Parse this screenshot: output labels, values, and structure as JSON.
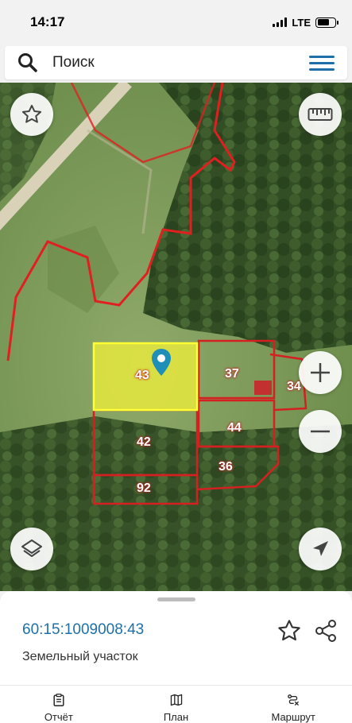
{
  "status_bar": {
    "time": "14:17",
    "network": "LTE"
  },
  "search": {
    "placeholder": "Поиск",
    "icon": "search-icon",
    "menu_icon": "hamburger-menu-icon"
  },
  "map": {
    "selected_parcel_label": "43",
    "parcel_labels": {
      "p43": "43",
      "p37": "37",
      "p34": "34",
      "p42": "42",
      "p44": "44",
      "p36": "36",
      "p92": "92"
    },
    "controls": {
      "favorite_icon": "star-icon",
      "ruler_icon": "ruler-icon",
      "zoom_in_icon": "plus-icon",
      "zoom_out_icon": "minus-icon",
      "layers_icon": "layers-icon",
      "location_icon": "navigation-arrow-icon"
    },
    "colors": {
      "boundary": "#e02020",
      "selected_fill": "#f2f23a",
      "selected_border": "#ffff33",
      "pin": "#1f8fb8"
    }
  },
  "sheet": {
    "cadastral_number": "60:15:1009008:43",
    "object_type": "Земельный участок"
  },
  "tabs": [
    {
      "label": "Отчёт",
      "icon": "clipboard-icon"
    },
    {
      "label": "План",
      "icon": "map-icon"
    },
    {
      "label": "Маршрут",
      "icon": "route-icon"
    }
  ]
}
